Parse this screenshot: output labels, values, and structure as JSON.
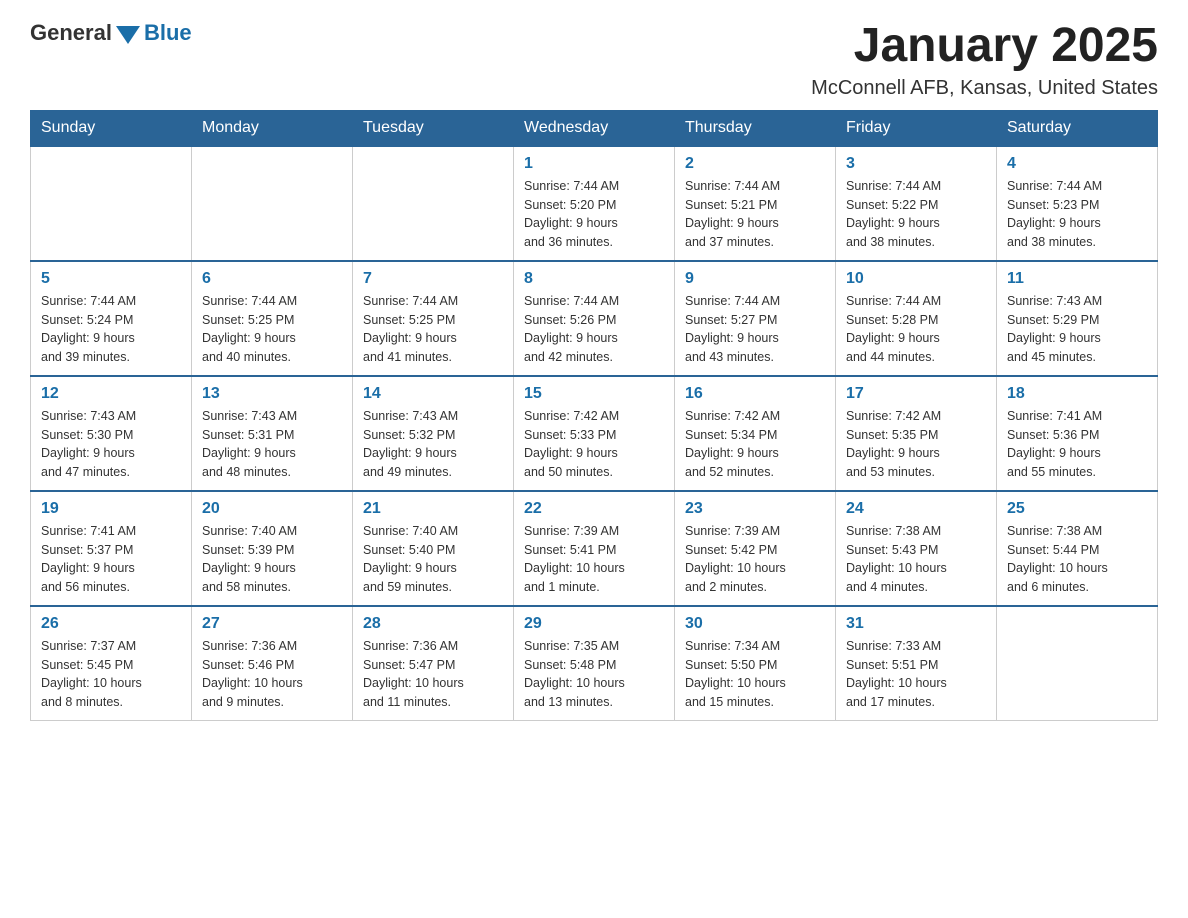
{
  "header": {
    "logo_general": "General",
    "logo_blue": "Blue",
    "month_title": "January 2025",
    "location": "McConnell AFB, Kansas, United States"
  },
  "weekdays": [
    "Sunday",
    "Monday",
    "Tuesday",
    "Wednesday",
    "Thursday",
    "Friday",
    "Saturday"
  ],
  "weeks": [
    [
      {
        "day": "",
        "info": ""
      },
      {
        "day": "",
        "info": ""
      },
      {
        "day": "",
        "info": ""
      },
      {
        "day": "1",
        "info": "Sunrise: 7:44 AM\nSunset: 5:20 PM\nDaylight: 9 hours\nand 36 minutes."
      },
      {
        "day": "2",
        "info": "Sunrise: 7:44 AM\nSunset: 5:21 PM\nDaylight: 9 hours\nand 37 minutes."
      },
      {
        "day": "3",
        "info": "Sunrise: 7:44 AM\nSunset: 5:22 PM\nDaylight: 9 hours\nand 38 minutes."
      },
      {
        "day": "4",
        "info": "Sunrise: 7:44 AM\nSunset: 5:23 PM\nDaylight: 9 hours\nand 38 minutes."
      }
    ],
    [
      {
        "day": "5",
        "info": "Sunrise: 7:44 AM\nSunset: 5:24 PM\nDaylight: 9 hours\nand 39 minutes."
      },
      {
        "day": "6",
        "info": "Sunrise: 7:44 AM\nSunset: 5:25 PM\nDaylight: 9 hours\nand 40 minutes."
      },
      {
        "day": "7",
        "info": "Sunrise: 7:44 AM\nSunset: 5:25 PM\nDaylight: 9 hours\nand 41 minutes."
      },
      {
        "day": "8",
        "info": "Sunrise: 7:44 AM\nSunset: 5:26 PM\nDaylight: 9 hours\nand 42 minutes."
      },
      {
        "day": "9",
        "info": "Sunrise: 7:44 AM\nSunset: 5:27 PM\nDaylight: 9 hours\nand 43 minutes."
      },
      {
        "day": "10",
        "info": "Sunrise: 7:44 AM\nSunset: 5:28 PM\nDaylight: 9 hours\nand 44 minutes."
      },
      {
        "day": "11",
        "info": "Sunrise: 7:43 AM\nSunset: 5:29 PM\nDaylight: 9 hours\nand 45 minutes."
      }
    ],
    [
      {
        "day": "12",
        "info": "Sunrise: 7:43 AM\nSunset: 5:30 PM\nDaylight: 9 hours\nand 47 minutes."
      },
      {
        "day": "13",
        "info": "Sunrise: 7:43 AM\nSunset: 5:31 PM\nDaylight: 9 hours\nand 48 minutes."
      },
      {
        "day": "14",
        "info": "Sunrise: 7:43 AM\nSunset: 5:32 PM\nDaylight: 9 hours\nand 49 minutes."
      },
      {
        "day": "15",
        "info": "Sunrise: 7:42 AM\nSunset: 5:33 PM\nDaylight: 9 hours\nand 50 minutes."
      },
      {
        "day": "16",
        "info": "Sunrise: 7:42 AM\nSunset: 5:34 PM\nDaylight: 9 hours\nand 52 minutes."
      },
      {
        "day": "17",
        "info": "Sunrise: 7:42 AM\nSunset: 5:35 PM\nDaylight: 9 hours\nand 53 minutes."
      },
      {
        "day": "18",
        "info": "Sunrise: 7:41 AM\nSunset: 5:36 PM\nDaylight: 9 hours\nand 55 minutes."
      }
    ],
    [
      {
        "day": "19",
        "info": "Sunrise: 7:41 AM\nSunset: 5:37 PM\nDaylight: 9 hours\nand 56 minutes."
      },
      {
        "day": "20",
        "info": "Sunrise: 7:40 AM\nSunset: 5:39 PM\nDaylight: 9 hours\nand 58 minutes."
      },
      {
        "day": "21",
        "info": "Sunrise: 7:40 AM\nSunset: 5:40 PM\nDaylight: 9 hours\nand 59 minutes."
      },
      {
        "day": "22",
        "info": "Sunrise: 7:39 AM\nSunset: 5:41 PM\nDaylight: 10 hours\nand 1 minute."
      },
      {
        "day": "23",
        "info": "Sunrise: 7:39 AM\nSunset: 5:42 PM\nDaylight: 10 hours\nand 2 minutes."
      },
      {
        "day": "24",
        "info": "Sunrise: 7:38 AM\nSunset: 5:43 PM\nDaylight: 10 hours\nand 4 minutes."
      },
      {
        "day": "25",
        "info": "Sunrise: 7:38 AM\nSunset: 5:44 PM\nDaylight: 10 hours\nand 6 minutes."
      }
    ],
    [
      {
        "day": "26",
        "info": "Sunrise: 7:37 AM\nSunset: 5:45 PM\nDaylight: 10 hours\nand 8 minutes."
      },
      {
        "day": "27",
        "info": "Sunrise: 7:36 AM\nSunset: 5:46 PM\nDaylight: 10 hours\nand 9 minutes."
      },
      {
        "day": "28",
        "info": "Sunrise: 7:36 AM\nSunset: 5:47 PM\nDaylight: 10 hours\nand 11 minutes."
      },
      {
        "day": "29",
        "info": "Sunrise: 7:35 AM\nSunset: 5:48 PM\nDaylight: 10 hours\nand 13 minutes."
      },
      {
        "day": "30",
        "info": "Sunrise: 7:34 AM\nSunset: 5:50 PM\nDaylight: 10 hours\nand 15 minutes."
      },
      {
        "day": "31",
        "info": "Sunrise: 7:33 AM\nSunset: 5:51 PM\nDaylight: 10 hours\nand 17 minutes."
      },
      {
        "day": "",
        "info": ""
      }
    ]
  ]
}
